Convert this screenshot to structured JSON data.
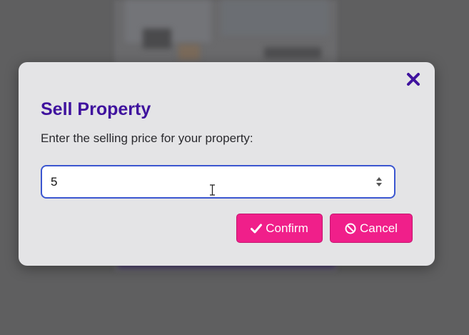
{
  "modal": {
    "title": "Sell Property",
    "prompt": "Enter the selling price for your property:",
    "price_input": {
      "value": "5",
      "placeholder": ""
    },
    "confirm_label": "Confirm",
    "cancel_label": "Cancel",
    "icons": {
      "close": "close-icon",
      "confirm": "check-icon",
      "cancel": "ban-icon"
    }
  },
  "colors": {
    "overlay": "#5f5f60",
    "modal_bg": "#e4e4e6",
    "title": "#3f129e",
    "input_border": "#3b56d0",
    "button_bg": "#f01f8a",
    "button_text": "#ffffff"
  }
}
